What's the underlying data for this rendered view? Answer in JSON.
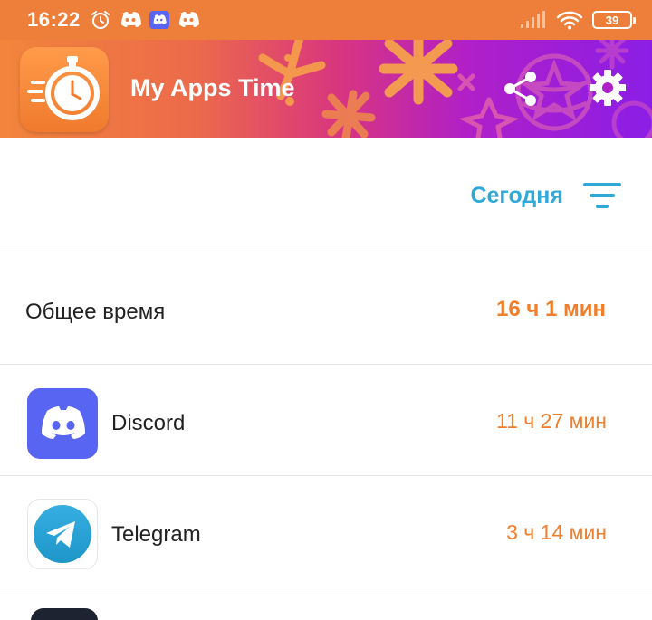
{
  "status_bar": {
    "time": "16:22",
    "battery": "39",
    "icons": [
      "alarm-icon",
      "discord-icon",
      "discord-icon",
      "discord-icon",
      "signal-icon",
      "wifi-icon",
      "battery-icon"
    ]
  },
  "header": {
    "title": "My Apps Time",
    "gradient_colors": [
      "#f2853c",
      "#d8357f",
      "#8b1ee6"
    ]
  },
  "filter": {
    "period": "Сегодня"
  },
  "total": {
    "label": "Общее время",
    "value": "16 ч 1 мин"
  },
  "apps": [
    {
      "name": "Discord",
      "time": "11 ч 27 мин",
      "icon": "discord-icon"
    },
    {
      "name": "Telegram",
      "time": "3 ч 14 мин",
      "icon": "telegram-icon"
    }
  ],
  "colors": {
    "status_bar": "#ee7f3a",
    "accent_orange": "#f07f2c",
    "accent_blue": "#2fa9d8",
    "discord": "#5865f2",
    "telegram": "#2aa1da"
  }
}
